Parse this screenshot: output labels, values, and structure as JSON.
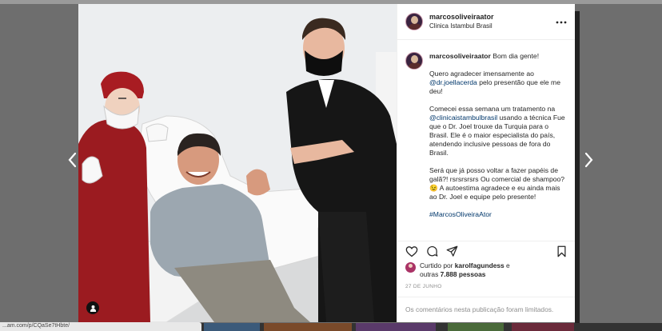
{
  "post": {
    "username": "marcosoliveiraator",
    "location": "Clinica Istambul Brasil",
    "more_icon": "more-dots-icon",
    "caption": {
      "greeting": "Bom dia gente!",
      "p1_before": "Quero agradecer imensamente ao ",
      "p1_mention": "@dr.joellacerda",
      "p1_after": " pelo presentão que ele me deu!",
      "p2_before": "Comecei essa semana um tratamento na ",
      "p2_mention": "@clinicaistambulbrasil",
      "p2_after": " usando a técnica Fue que o Dr. Joel trouxe da Turquia para o Brasil. Ele é o maior especialista do país, atendendo inclusive pessoas de fora do Brasil.",
      "p3": "Será que já posso voltar a fazer papéis de galã?! rsrsrsrsrs Ou comercial de shampoo? 😉 A autoestima agradece e eu ainda mais ao Dr. Joel e equipe pelo presente!",
      "hashtag": "#MarcosOliveiraAtor"
    },
    "likes": {
      "prefix": "Curtido por ",
      "first_user": "karolfagundess",
      "middle": " e",
      "others_prefix": "outras ",
      "others_count": "7.888 pessoas"
    },
    "date": "27 DE JUNHO",
    "comments_limited": "Os comentários nesta publicação foram limitados."
  },
  "browser": {
    "status_url": "...am.com/p/CQaSe7tHbte/"
  },
  "icons": [
    "heart-icon",
    "comment-icon",
    "share-icon",
    "bookmark-icon",
    "user-tag-icon",
    "chevron-left-icon",
    "chevron-right-icon"
  ],
  "colors": {
    "overlay": "#6e6e6e",
    "mention": "#00376b",
    "text": "#262626",
    "muted": "#8e8e8e"
  }
}
